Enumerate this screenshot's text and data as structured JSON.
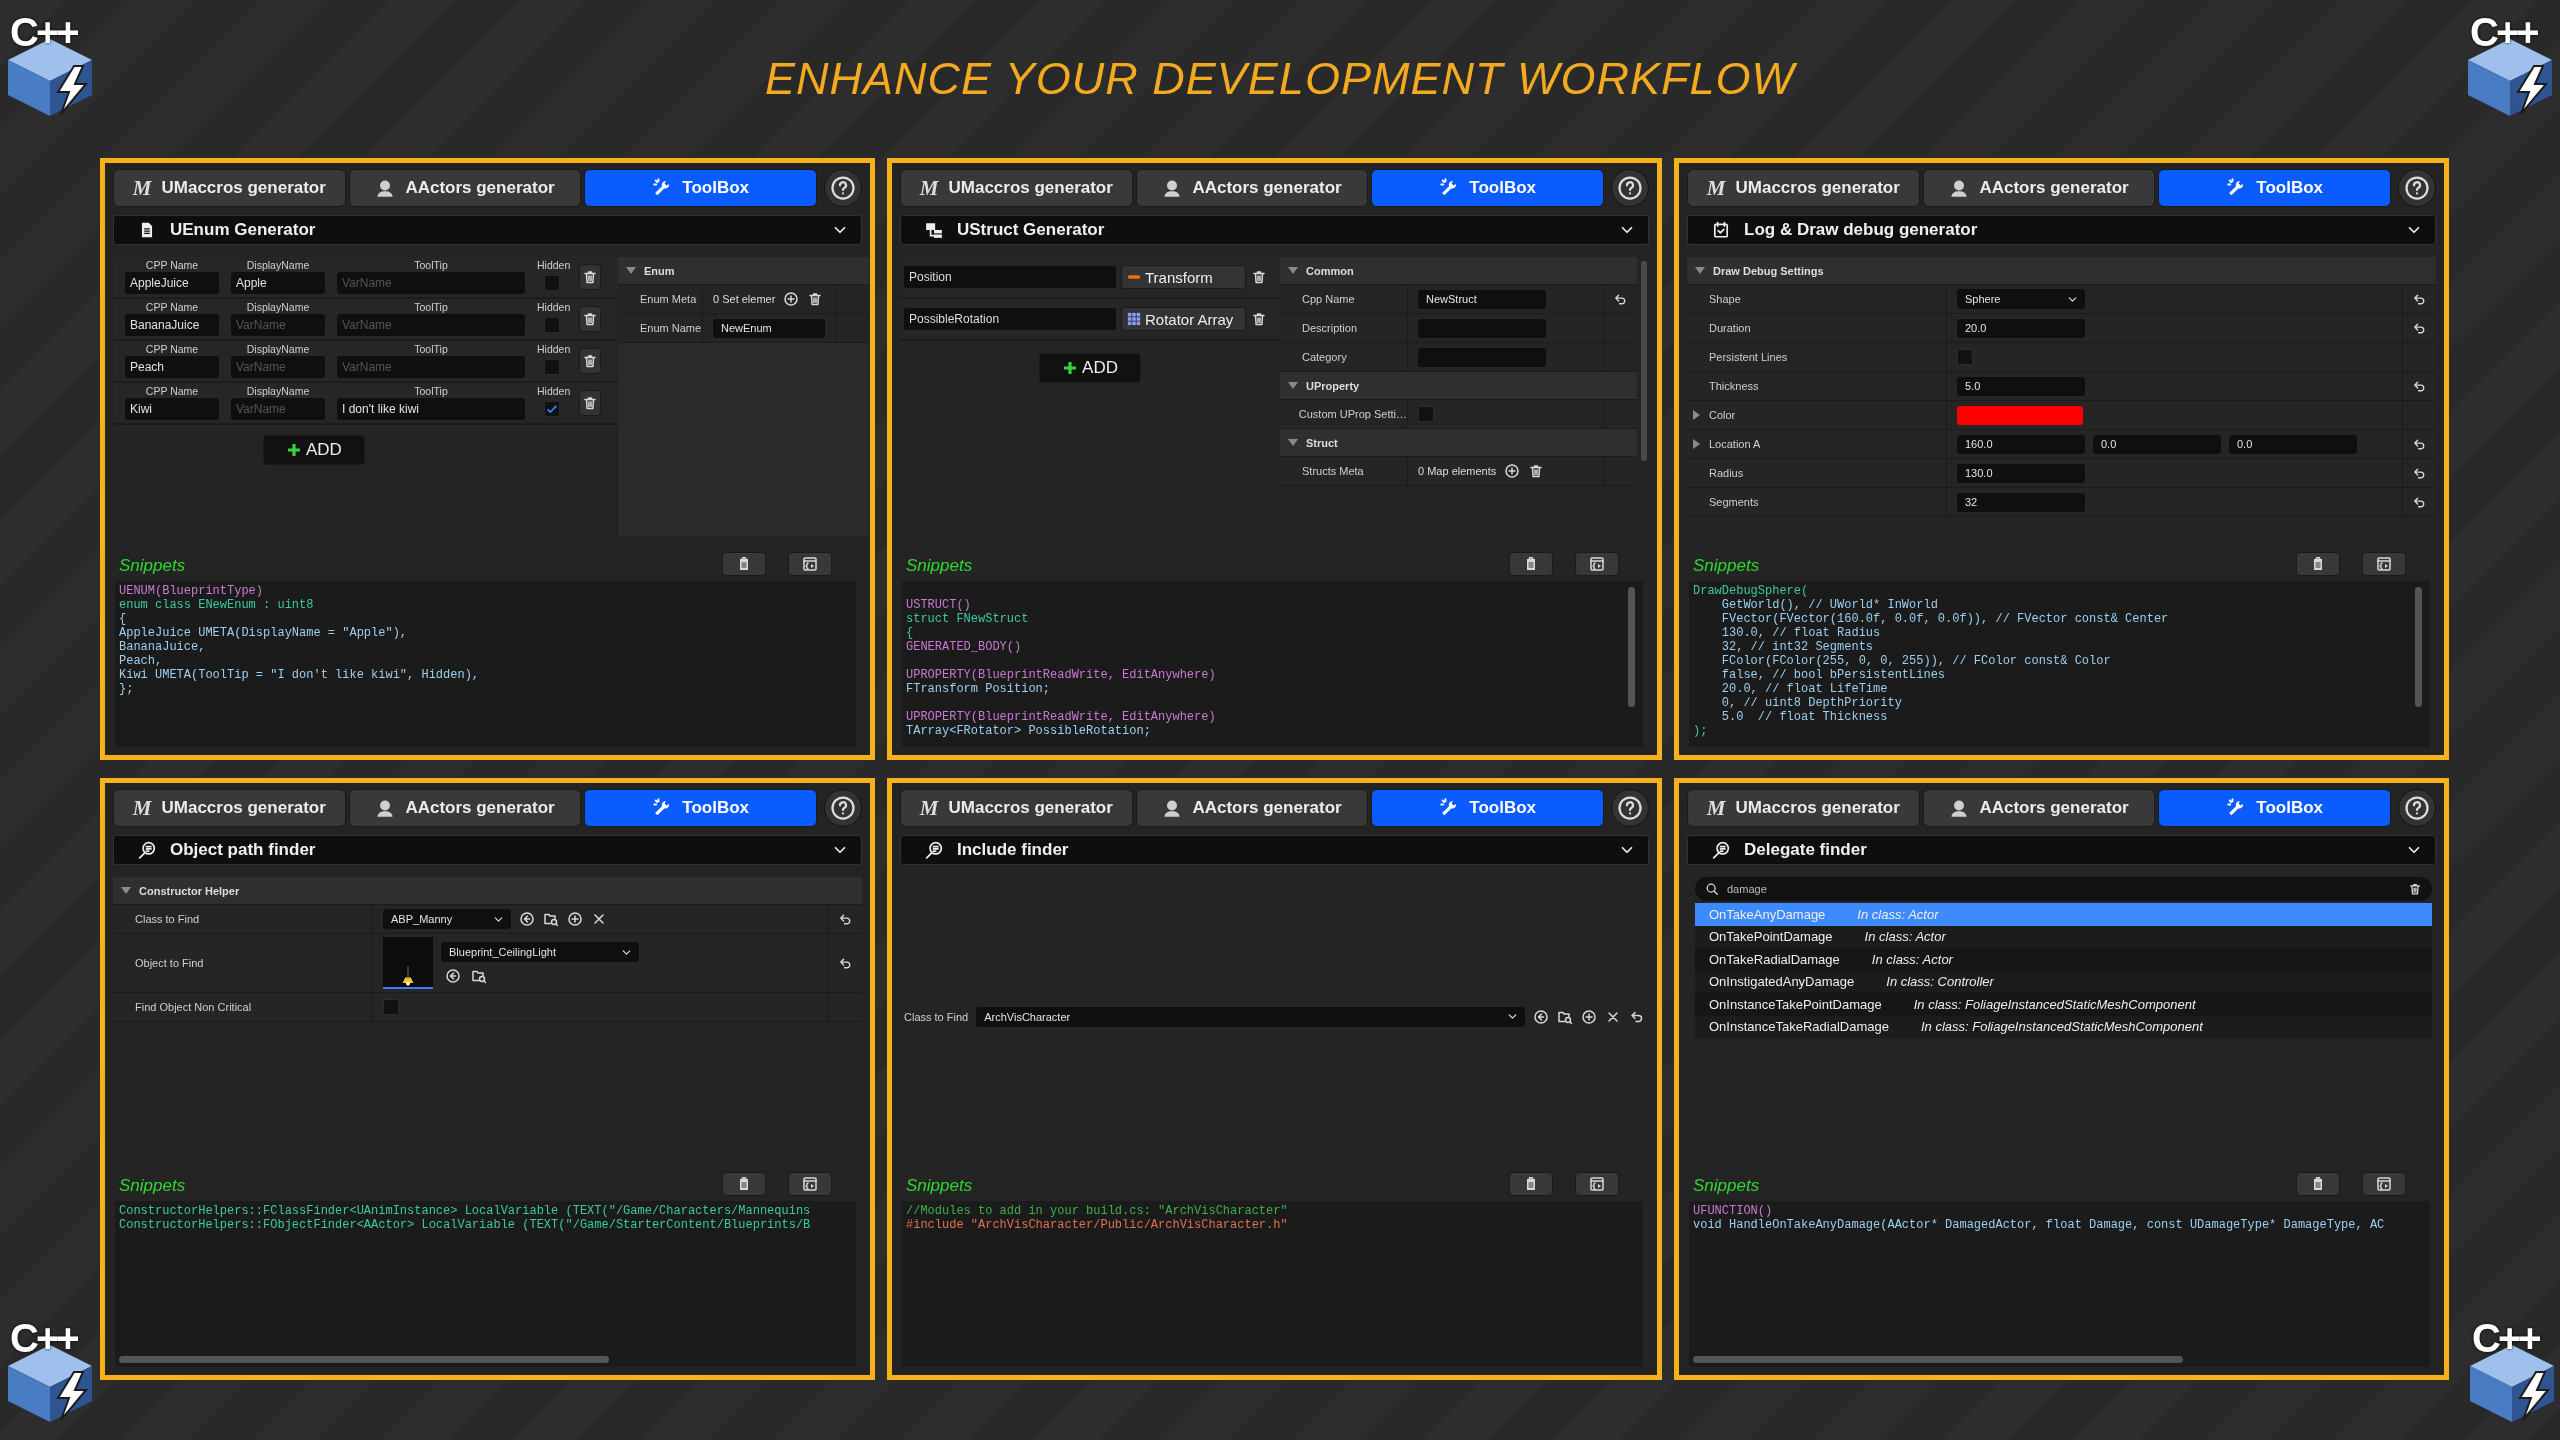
{
  "title": "ENHANCE YOUR DEVELOPMENT WORKFLOW",
  "logos": [
    "C++",
    "C++",
    "C++",
    "C++"
  ],
  "panels": [
    {
      "tabs": [
        {
          "label": "UMaccros generator",
          "glyph": "M",
          "selected": false
        },
        {
          "label": "AActors generator",
          "selected": false
        },
        {
          "label": "ToolBox",
          "selected": true
        }
      ],
      "tool": {
        "title": "UEnum Generator"
      },
      "body": {
        "kind": "enum",
        "add": "ADD",
        "rows": [
          {
            "labels": [
              "CPP Name",
              "DisplayName",
              "ToolTip",
              "Hidden"
            ],
            "cpp": {
              "value": "AppleJuice"
            },
            "display": {
              "value": "Apple"
            },
            "tooltip": {
              "placeholder": "VarName"
            },
            "hidden": false
          },
          {
            "labels": [
              "CPP Name",
              "DisplayName",
              "ToolTip",
              "Hidden"
            ],
            "cpp": {
              "value": "BananaJuice"
            },
            "display": {
              "placeholder": "VarName"
            },
            "tooltip": {
              "placeholder": "VarName"
            },
            "hidden": false
          },
          {
            "labels": [
              "CPP Name",
              "DisplayName",
              "ToolTip",
              "Hidden"
            ],
            "cpp": {
              "value": "Peach"
            },
            "display": {
              "placeholder": "VarName"
            },
            "tooltip": {
              "placeholder": "VarName"
            },
            "hidden": false
          },
          {
            "labels": [
              "CPP Name",
              "DisplayName",
              "ToolTip",
              "Hidden"
            ],
            "cpp": {
              "value": "Kiwi"
            },
            "display": {
              "placeholder": "VarName"
            },
            "tooltip": {
              "value": "I don't like kiwi"
            },
            "hidden": true
          }
        ],
        "sections": [
          {
            "title": "Enum",
            "expanded": true,
            "rows": [
              {
                "label": "Enum Meta",
                "kind": "elements",
                "value": "0 Set elemer",
                "reset": false
              },
              {
                "label": "Enum Name",
                "kind": "text",
                "value": "NewEnum",
                "reset": false
              }
            ]
          }
        ]
      },
      "snippets": {
        "label": "Snippets",
        "vscroll": false,
        "hscroll": false,
        "code": [
          {
            "color": "#c87ad0",
            "text": "UENUM(BlueprintType)"
          },
          {
            "color": "#3cc9a0",
            "text": "enum class ENewEnum : uint8"
          },
          {
            "color": "#9ccff0",
            "text": "{"
          },
          {
            "color": "#9ccff0",
            "text": "AppleJuice UMETA(DisplayName = \"Apple\"),"
          },
          {
            "color": "#9ccff0",
            "text": "BananaJuice,"
          },
          {
            "color": "#9ccff0",
            "text": "Peach,"
          },
          {
            "color": "#9ccff0",
            "text": "Kiwi UMETA(ToolTip = \"I don't like kiwi\", Hidden),"
          },
          {
            "color": "#9ccff0",
            "text": "};"
          }
        ]
      }
    },
    {
      "tabs": [
        {
          "label": "UMaccros generator",
          "glyph": "M",
          "selected": false
        },
        {
          "label": "AActors generator",
          "selected": false
        },
        {
          "label": "ToolBox",
          "selected": true
        }
      ],
      "tool": {
        "title": "UStruct Generator"
      },
      "body": {
        "kind": "struct",
        "add": "ADD",
        "members": [
          {
            "name": "Position",
            "type": "Transform",
            "kind": "single"
          },
          {
            "name": "PossibleRotation",
            "type": "Rotator Array",
            "kind": "array"
          }
        ],
        "sections": [
          {
            "title": "Common",
            "expanded": true,
            "rows": [
              {
                "label": "Cpp Name",
                "kind": "text",
                "value": "NewStruct",
                "reset": true
              },
              {
                "label": "Description",
                "kind": "text",
                "reset": false
              },
              {
                "label": "Category",
                "kind": "text",
                "reset": false
              }
            ]
          },
          {
            "title": "UProperty",
            "expanded": true,
            "rows": [
              {
                "label": "Custom UProp Setti…",
                "kind": "checkbox",
                "checked": false,
                "reset": false
              }
            ]
          },
          {
            "title": "Struct",
            "expanded": true,
            "rows": [
              {
                "label": "Structs Meta",
                "kind": "elements",
                "value": "0 Map elements",
                "reset": false
              }
            ]
          }
        ]
      },
      "snippets": {
        "label": "Snippets",
        "vscroll": true,
        "hscroll": false,
        "code": [
          {
            "color": "#c87ad0",
            "text": "USTRUCT()",
            "space_before": true
          },
          {
            "color": "#3cc9a0",
            "text": "struct FNewStruct"
          },
          {
            "color": "#3cc9a0",
            "text": "{"
          },
          {
            "color": "#c87ad0",
            "text": "GENERATED_BODY()"
          },
          {
            "color": "#c87ad0",
            "text": "UPROPERTY(BlueprintReadWrite, EditAnywhere)",
            "space_before": true
          },
          {
            "color": "#9ccff0",
            "text": "FTransform Position;"
          },
          {
            "color": "#c87ad0",
            "text": "UPROPERTY(BlueprintReadWrite, EditAnywhere)",
            "space_before": true
          },
          {
            "color": "#9ccff0",
            "text": "TArray<FRotator> PossibleRotation;"
          }
        ]
      }
    },
    {
      "tabs": [
        {
          "label": "UMaccros generator",
          "glyph": "M",
          "selected": false
        },
        {
          "label": "AActors generator",
          "selected": false
        },
        {
          "label": "ToolBox",
          "selected": true
        }
      ],
      "tool": {
        "title": "Log & Draw debug generator"
      },
      "body": {
        "kind": "debug",
        "sections": [
          {
            "title": "Draw Debug Settings",
            "expanded": true,
            "rows": [
              {
                "label": "Shape",
                "kind": "dropdown",
                "value": "Sphere",
                "reset": true
              },
              {
                "label": "Duration",
                "kind": "text",
                "value": "20.0",
                "reset": true
              },
              {
                "label": "Persistent Lines",
                "kind": "checkbox",
                "checked": false,
                "reset": false
              },
              {
                "label": "Thickness",
                "kind": "text",
                "value": "5.0",
                "reset": true
              },
              {
                "label": "Color",
                "kind": "color",
                "color": "#ff0000",
                "expanded": false,
                "reset": false
              },
              {
                "label": "Location A",
                "kind": "vector",
                "values": [
                  "160.0",
                  "0.0",
                  "0.0"
                ],
                "expanded": false,
                "reset": true
              },
              {
                "label": "Radius",
                "kind": "text",
                "value": "130.0",
                "reset": true
              },
              {
                "label": "Segments",
                "kind": "text",
                "value": "32",
                "reset": true
              }
            ]
          }
        ]
      },
      "snippets": {
        "label": "Snippets",
        "vscroll": true,
        "hscroll": false,
        "code": [
          {
            "color": "#3cc9a0",
            "text": "DrawDebugSphere("
          },
          {
            "color": "#9ccff0",
            "text": "    GetWorld(), // UWorld* InWorld"
          },
          {
            "color": "#9ccff0",
            "text": "    FVector(FVector(160.0f, 0.0f, 0.0f)), // FVector const& Center"
          },
          {
            "color": "#9ccff0",
            "text": "    130.0, // float Radius"
          },
          {
            "color": "#9ccff0",
            "text": "    32, // int32 Segments"
          },
          {
            "color": "#9ccff0",
            "text": "    FColor(FColor(255, 0, 0, 255)), // FColor const& Color"
          },
          {
            "color": "#9ccff0",
            "text": "    false, // bool bPersistentLines"
          },
          {
            "color": "#9ccff0",
            "text": "    20.0, // float LifeTime"
          },
          {
            "color": "#9ccff0",
            "text": "    0, // uint8 DepthPriority"
          },
          {
            "color": "#9ccff0",
            "text": "    5.0  // float Thickness"
          },
          {
            "color": "#3cc9a0",
            "text": ");"
          }
        ]
      }
    },
    {
      "tabs": [
        {
          "label": "UMaccros generator",
          "glyph": "M",
          "selected": false
        },
        {
          "label": "AActors generator",
          "selected": false
        },
        {
          "label": "ToolBox",
          "selected": true
        }
      ],
      "tool": {
        "title": "Object path finder"
      },
      "body": {
        "kind": "object",
        "sections": [
          {
            "title": "Constructor Helper",
            "expanded": true,
            "rows": [
              {
                "label": "Class to Find",
                "kind": "class_picker",
                "value": "ABP_Manny",
                "reset": true
              },
              {
                "label": "Object to Find",
                "kind": "asset",
                "value": "Blueprint_CeilingLight",
                "reset": true
              },
              {
                "label": "Find Object Non Critical",
                "kind": "checkbox",
                "checked": false,
                "reset": false
              }
            ]
          }
        ]
      },
      "snippets": {
        "label": "Snippets",
        "vscroll": false,
        "hscroll": true,
        "code": [
          {
            "color": "#3cc9a0",
            "text": "ConstructorHelpers::FClassFinder<UAnimInstance> LocalVariable (TEXT(\"/Game/Characters/Mannequins"
          },
          {
            "color": "#3cc9a0",
            "text": "ConstructorHelpers::FObjectFinder<AActor> LocalVariable (TEXT(\"/Game/StarterContent/Blueprints/B"
          }
        ]
      }
    },
    {
      "tabs": [
        {
          "label": "UMaccros generator",
          "glyph": "M",
          "selected": false
        },
        {
          "label": "AActors generator",
          "selected": false
        },
        {
          "label": "ToolBox",
          "selected": true
        }
      ],
      "tool": {
        "title": "Include finder"
      },
      "body": {
        "kind": "include",
        "label": "Class to Find",
        "value": "ArchVisCharacter",
        "reset": true
      },
      "snippets": {
        "label": "Snippets",
        "vscroll": false,
        "hscroll": false,
        "code": [
          {
            "color": "#3db04a",
            "text": "//Modules to add in your build.cs: \"ArchVisCharacter\""
          },
          {
            "color": "#e0714a",
            "text": "#include \"ArchVisCharacter/Public/ArchVisCharacter.h\""
          }
        ]
      }
    },
    {
      "tabs": [
        {
          "label": "UMaccros generator",
          "glyph": "M",
          "selected": false
        },
        {
          "label": "AActors generator",
          "selected": false
        },
        {
          "label": "ToolBox",
          "selected": true
        }
      ],
      "tool": {
        "title": "Delegate finder"
      },
      "body": {
        "kind": "delegate",
        "search": {
          "value": "damage"
        },
        "items": [
          {
            "name": "OnTakeAnyDamage",
            "class": "In class: Actor",
            "selected": true
          },
          {
            "name": "OnTakePointDamage",
            "class": "In class: Actor",
            "selected": false
          },
          {
            "name": "OnTakeRadialDamage",
            "class": "In class: Actor",
            "selected": false
          },
          {
            "name": "OnInstigatedAnyDamage",
            "class": "In class: Controller",
            "selected": false
          },
          {
            "name": "OnInstanceTakePointDamage",
            "class": "In class: FoliageInstancedStaticMeshComponent",
            "selected": false
          },
          {
            "name": "OnInstanceTakeRadialDamage",
            "class": "In class: FoliageInstancedStaticMeshComponent",
            "selected": false
          }
        ]
      },
      "snippets": {
        "label": "Snippets",
        "vscroll": false,
        "hscroll": true,
        "code": [
          {
            "color": "#c87ad0",
            "text": "UFUNCTION()"
          },
          {
            "color": "#9ccff0",
            "text": "void HandleOnTakeAnyDamage(AActor* DamagedActor, float Damage, const UDamageType* DamageType, AC"
          }
        ]
      }
    }
  ]
}
